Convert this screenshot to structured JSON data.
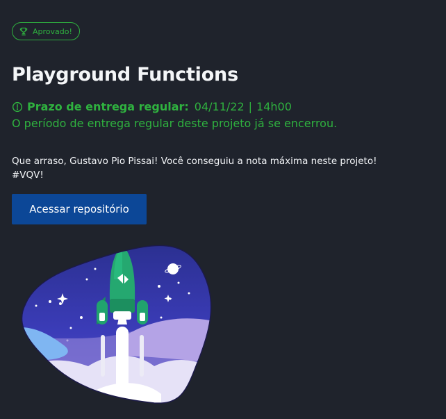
{
  "badge": {
    "label": "Aprovado!",
    "icon": "trophy-icon",
    "color": "#2fb23f"
  },
  "project": {
    "title": "Playground Functions"
  },
  "deadline": {
    "icon": "alert-circle-icon",
    "label": "Prazo de entrega regular:",
    "date": "04/11/22",
    "separator": "|",
    "time": "14h00",
    "status_text": "O período de entrega regular deste projeto já se encerrou."
  },
  "message": {
    "line1": "Que arraso, Gustavo Pio Pissai! Você conseguiu a nota máxima neste projeto!",
    "line2": "#VQV!"
  },
  "actions": {
    "repo_button_label": "Acessar repositório"
  },
  "colors": {
    "background": "#1f232c",
    "success": "#2fb23f",
    "primary_button": "#0c4797"
  }
}
